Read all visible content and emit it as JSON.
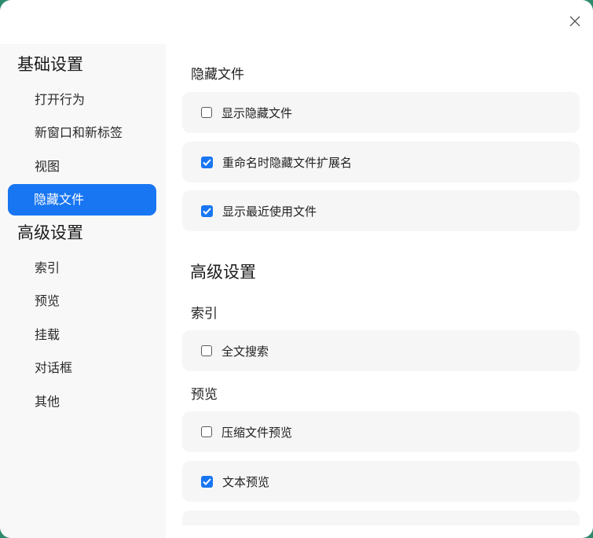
{
  "sidebar": {
    "groups": [
      {
        "label": "基础设置",
        "items": [
          "打开行为",
          "新窗口和新标签",
          "视图",
          "隐藏文件"
        ]
      },
      {
        "label": "高级设置",
        "items": [
          "索引",
          "预览",
          "挂载",
          "对话框",
          "其他"
        ]
      }
    ],
    "active_item": "隐藏文件"
  },
  "content": {
    "hidden_files": {
      "title": "隐藏文件",
      "options": [
        {
          "label": "显示隐藏文件",
          "checked": false
        },
        {
          "label": "重命名时隐藏文件扩展名",
          "checked": true
        },
        {
          "label": "显示最近使用文件",
          "checked": true
        }
      ]
    },
    "advanced": {
      "title": "高级设置",
      "index": {
        "title": "索引",
        "options": [
          {
            "label": "全文搜索",
            "checked": false
          }
        ]
      },
      "preview": {
        "title": "预览",
        "options": [
          {
            "label": "压缩文件预览",
            "checked": false
          },
          {
            "label": "文本预览",
            "checked": true
          },
          {
            "label": "",
            "checked": true
          }
        ]
      }
    }
  },
  "colors": {
    "accent": "#1876f2",
    "sidebar_bg": "#f8f8f8",
    "row_bg": "#f6f6f6"
  },
  "icons": {
    "close": "close-icon",
    "check": "checkmark-icon"
  }
}
